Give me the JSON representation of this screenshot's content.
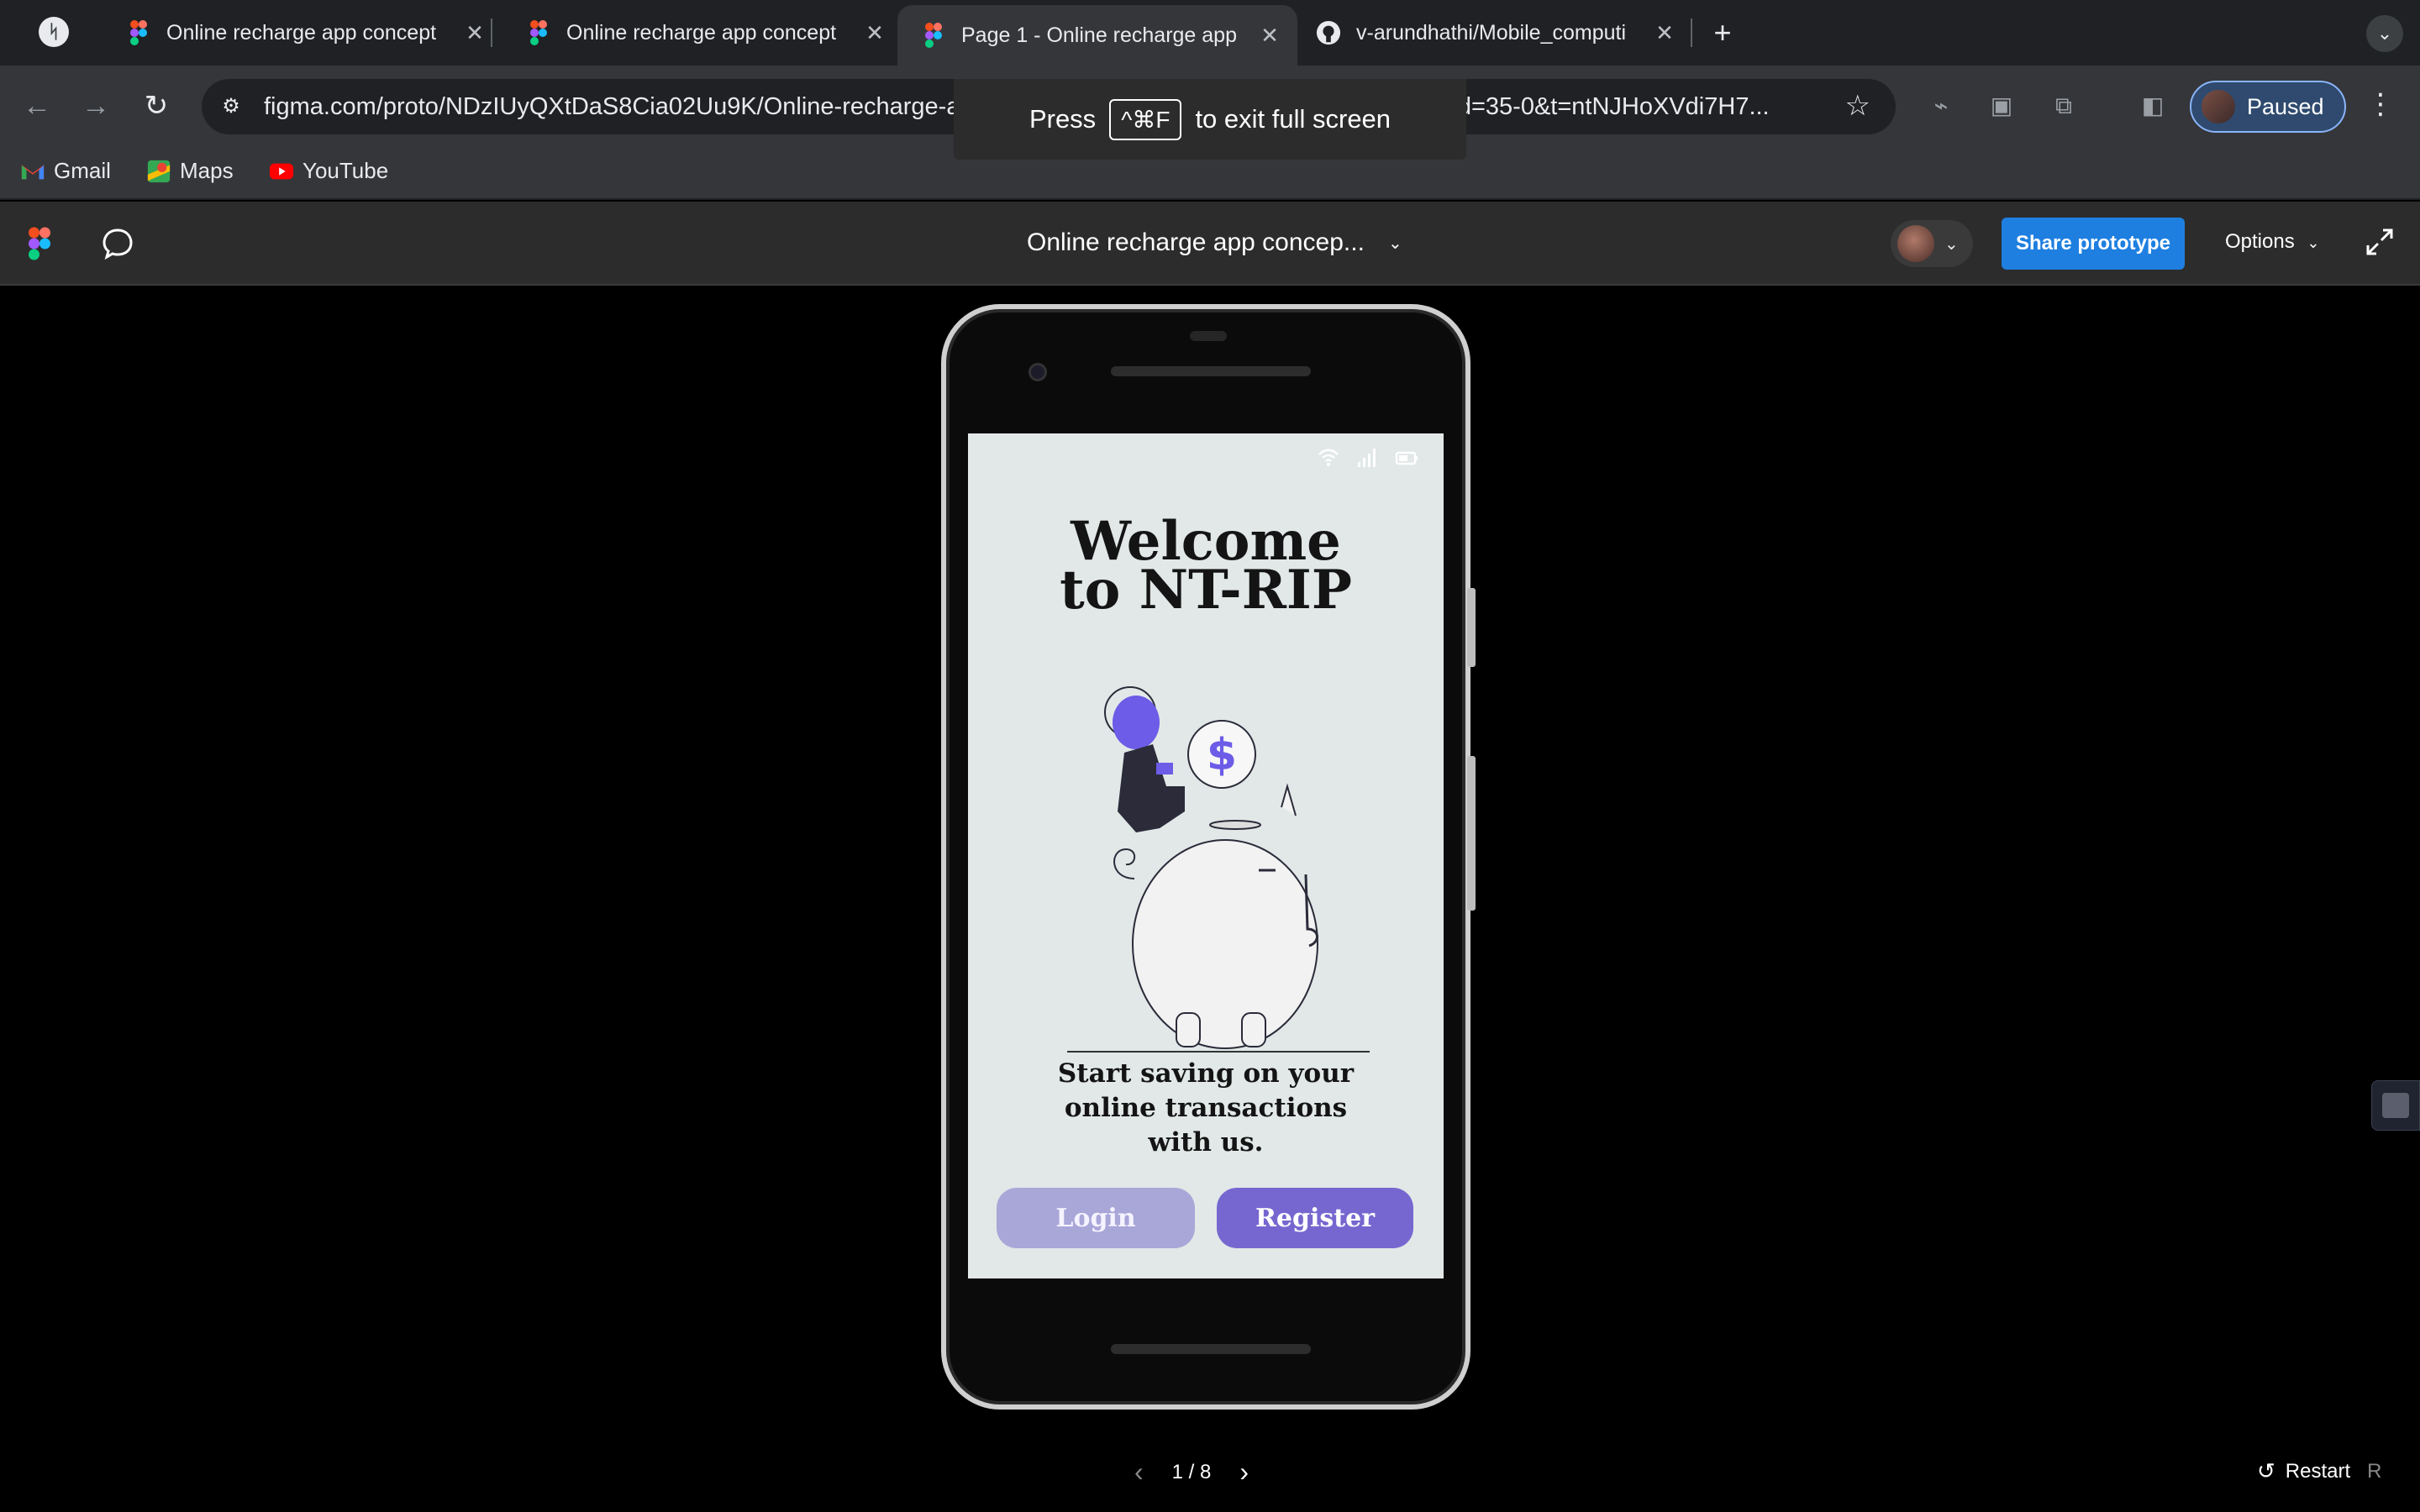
{
  "tabs": [
    {
      "title": "Online recharge app concept",
      "favicon": "figma-icon",
      "active": false
    },
    {
      "title": "Online recharge app concept",
      "favicon": "figma-icon",
      "active": false
    },
    {
      "title": "Page 1 - Online recharge app",
      "favicon": "figma-icon",
      "active": true
    },
    {
      "title": "v-arundhathi/Mobile_computi",
      "favicon": "github-icon",
      "active": false
    }
  ],
  "toolbar": {
    "url": "figma.com/proto/NDzIUyQXtDaS8Cia02Uu9K/Online-recharge-app-concept-(Community)?type=design&node-id=35-0&t=ntNJHoXVdi7H7...",
    "profile_label": "Paused"
  },
  "fullscreen_notice": {
    "press": "Press",
    "keys": "^⌘F",
    "rest": "to exit full screen"
  },
  "bookmarks": [
    {
      "label": "Gmail",
      "icon": "gmail-icon"
    },
    {
      "label": "Maps",
      "icon": "maps-icon"
    },
    {
      "label": "YouTube",
      "icon": "youtube-icon"
    }
  ],
  "figma": {
    "file_title": "Online recharge app concep...",
    "share_label": "Share prototype",
    "options_label": "Options"
  },
  "app": {
    "welcome_line1": "Welcome",
    "welcome_line2": "to NT-RIP",
    "tagline_line1": "Start saving on your",
    "tagline_line2": "online transactions",
    "tagline_line3": "with us.",
    "login_label": "Login",
    "register_label": "Register",
    "coin_symbol": "$"
  },
  "footer": {
    "page_indicator": "1 / 8",
    "restart_label": "Restart",
    "restart_key": "R"
  },
  "colors": {
    "screen_bg": "#e1e8e7",
    "login_bg": "#a9a6d8",
    "register_bg": "#7667d0",
    "share_bg": "#1e7fe0",
    "accent_illustration": "#6c5ce7"
  }
}
